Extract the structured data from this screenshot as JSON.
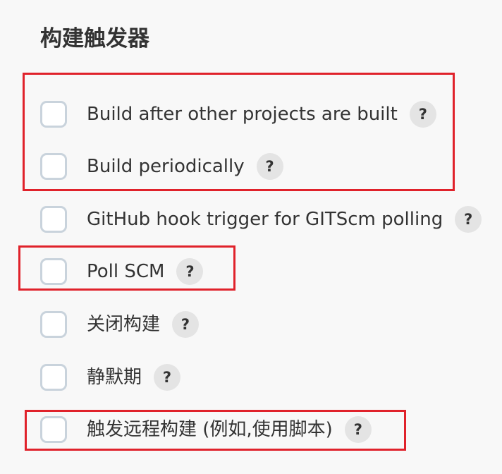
{
  "section": {
    "title": "构建触发器"
  },
  "options": [
    {
      "label": "Build after other projects are built",
      "help": "?",
      "checked": false
    },
    {
      "label": "Build periodically",
      "help": "?",
      "checked": false
    },
    {
      "label": "GitHub hook trigger for GITScm polling",
      "help": "?",
      "checked": false
    },
    {
      "label": "Poll SCM",
      "help": "?",
      "checked": false
    },
    {
      "label": "关闭构建",
      "help": "?",
      "checked": false
    },
    {
      "label": "静默期",
      "help": "?",
      "checked": false
    },
    {
      "label": "触发远程构建 (例如,使用脚本)",
      "help": "?",
      "checked": false
    }
  ],
  "colors": {
    "highlight": "#e0222b",
    "checkbox_border": "#c9d3dc",
    "help_bg": "#e4e4e4",
    "text": "#333333",
    "background": "#f8f8f8"
  }
}
